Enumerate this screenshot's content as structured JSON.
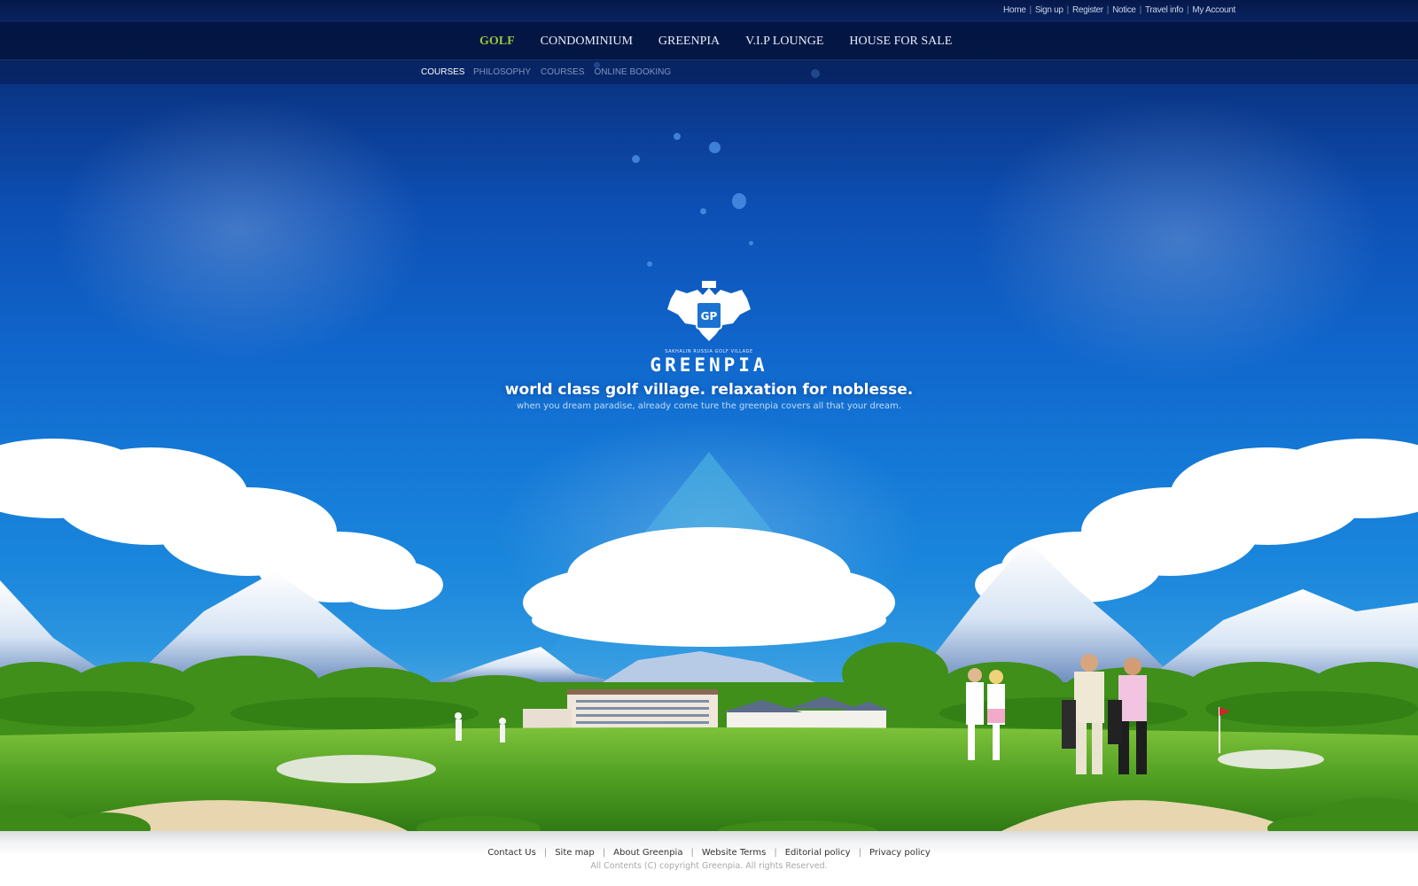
{
  "utility_links": [
    "Home",
    "Sign up",
    "Register",
    "Notice",
    "Travel info",
    "My Account"
  ],
  "main_nav": {
    "items": [
      "GOLF",
      "CONDOMINIUM",
      "GREENPIA",
      "V.I.P LOUNGE",
      "HOUSE FOR SALE"
    ],
    "active": "GOLF",
    "active_color": "#9ac43c"
  },
  "sub_nav": {
    "current": "COURSES",
    "items": [
      "PHILOSOPHY",
      "COURSES",
      "ONLINE BOOKING"
    ]
  },
  "hero": {
    "logo_tagline": "SAKHALIN RUSSIA GOLF VILLAGE",
    "logo_name": "GREENPIA",
    "emblem_letters": "GP",
    "headline": "world class golf village. relaxation for noblesse.",
    "subline": "when you dream paradise, already come ture the greenpia covers all that your dream."
  },
  "footer": {
    "links": [
      "Contact Us",
      "Site map",
      "About Greenpia",
      "Website Terms",
      "Editorial policy",
      "Privacy policy"
    ],
    "copyright": "All Contents (C) copyright Greenpia. All rights Reserved."
  },
  "colors": {
    "sky_top": "#061d58",
    "sky_mid": "#1066cc",
    "grass": "#4f9e22",
    "nav_bg": "#03123a"
  }
}
